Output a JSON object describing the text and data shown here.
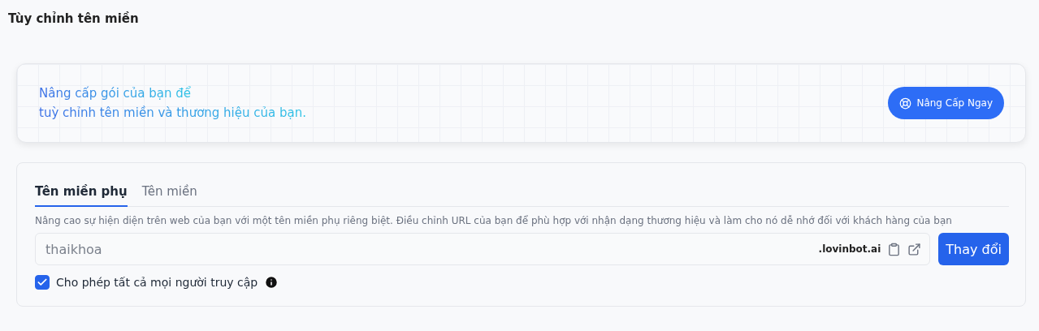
{
  "page_title": "Tùy chỉnh tên miền",
  "upgrade_banner": {
    "line_1": "Nâng cấp gói của bạn để",
    "line_2": "tuỳ chỉnh tên miền và thương hiệu của bạn.",
    "button": "Nâng Cấp Ngay"
  },
  "tabs": [
    {
      "label": "Tên miền phụ",
      "selected": true
    },
    {
      "label": "Tên miền",
      "selected": false
    }
  ],
  "description": "Nâng cao sự hiện diện trên web của bạn với một tên miền phụ riêng biệt. Điều chỉnh URL của bạn để phù hợp với nhận dạng thương hiệu và làm cho nó dễ nhớ đối với khách hàng của bạn",
  "subdomain_field": {
    "value": "thaikhoa",
    "suffix": ".lovinbot.ai"
  },
  "change_button": "Thay đổi",
  "public_access": {
    "label": "Cho phép tất cả mọi người truy cập",
    "checked": true
  }
}
